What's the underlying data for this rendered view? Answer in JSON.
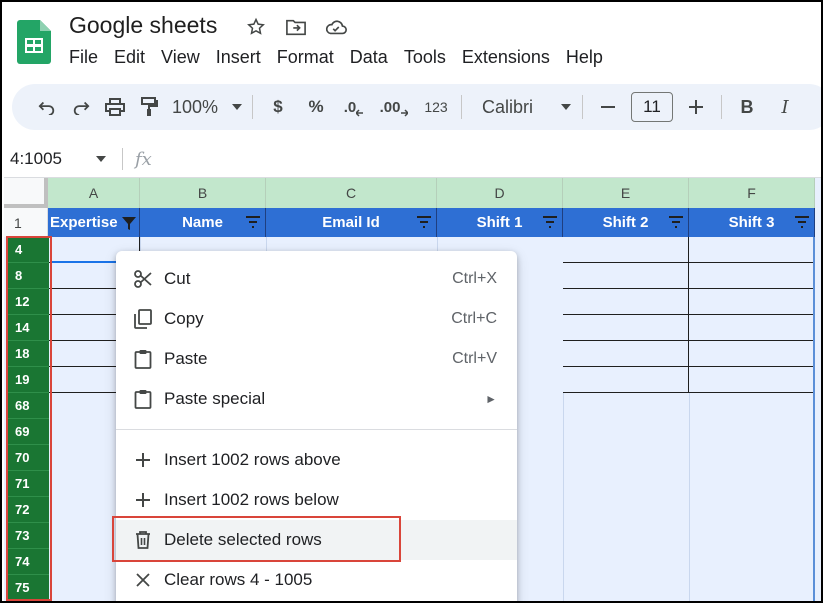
{
  "app": {
    "title": "Google sheets",
    "menus": [
      "File",
      "Edit",
      "View",
      "Insert",
      "Format",
      "Data",
      "Tools",
      "Extensions",
      "Help"
    ]
  },
  "toolbar": {
    "zoom": "100%",
    "currency": "$",
    "percent": "%",
    "decrease_decimal": ".0",
    "increase_decimal": ".00",
    "number_format": "123",
    "font": "Calibri",
    "font_size": "11",
    "bold": "B",
    "italic": "I"
  },
  "formula_bar": {
    "name_box": "4:1005",
    "fx": "fx"
  },
  "columns": [
    "A",
    "B",
    "C",
    "D",
    "E",
    "F"
  ],
  "header_row": {
    "row_number": "1",
    "cells": [
      "Expertise",
      "Name",
      "Email Id",
      "Shift 1",
      "Shift 2",
      "Shift 3"
    ]
  },
  "selected_rows": [
    "4",
    "8",
    "12",
    "14",
    "18",
    "19",
    "68",
    "69",
    "70",
    "71",
    "72",
    "73",
    "74",
    "75"
  ],
  "context_menu": {
    "items": [
      {
        "label": "Cut",
        "shortcut": "Ctrl+X",
        "icon": "scissors-icon"
      },
      {
        "label": "Copy",
        "shortcut": "Ctrl+C",
        "icon": "copy-icon"
      },
      {
        "label": "Paste",
        "shortcut": "Ctrl+V",
        "icon": "clipboard-icon"
      },
      {
        "label": "Paste special",
        "shortcut": "",
        "icon": "clipboard-icon"
      },
      {
        "label": "Insert 1002 rows above",
        "shortcut": "",
        "icon": "plus-icon"
      },
      {
        "label": "Insert 1002 rows below",
        "shortcut": "",
        "icon": "plus-icon"
      },
      {
        "label": "Delete selected rows",
        "shortcut": "",
        "icon": "trash-icon"
      },
      {
        "label": "Clear rows 4 - 1005",
        "shortcut": "",
        "icon": "close-icon"
      }
    ]
  },
  "colors": {
    "header_blue": "#2e6fd4",
    "row_green": "#1a7633",
    "column_header_green": "#c2e7cc",
    "highlight_red": "#d9453a"
  }
}
